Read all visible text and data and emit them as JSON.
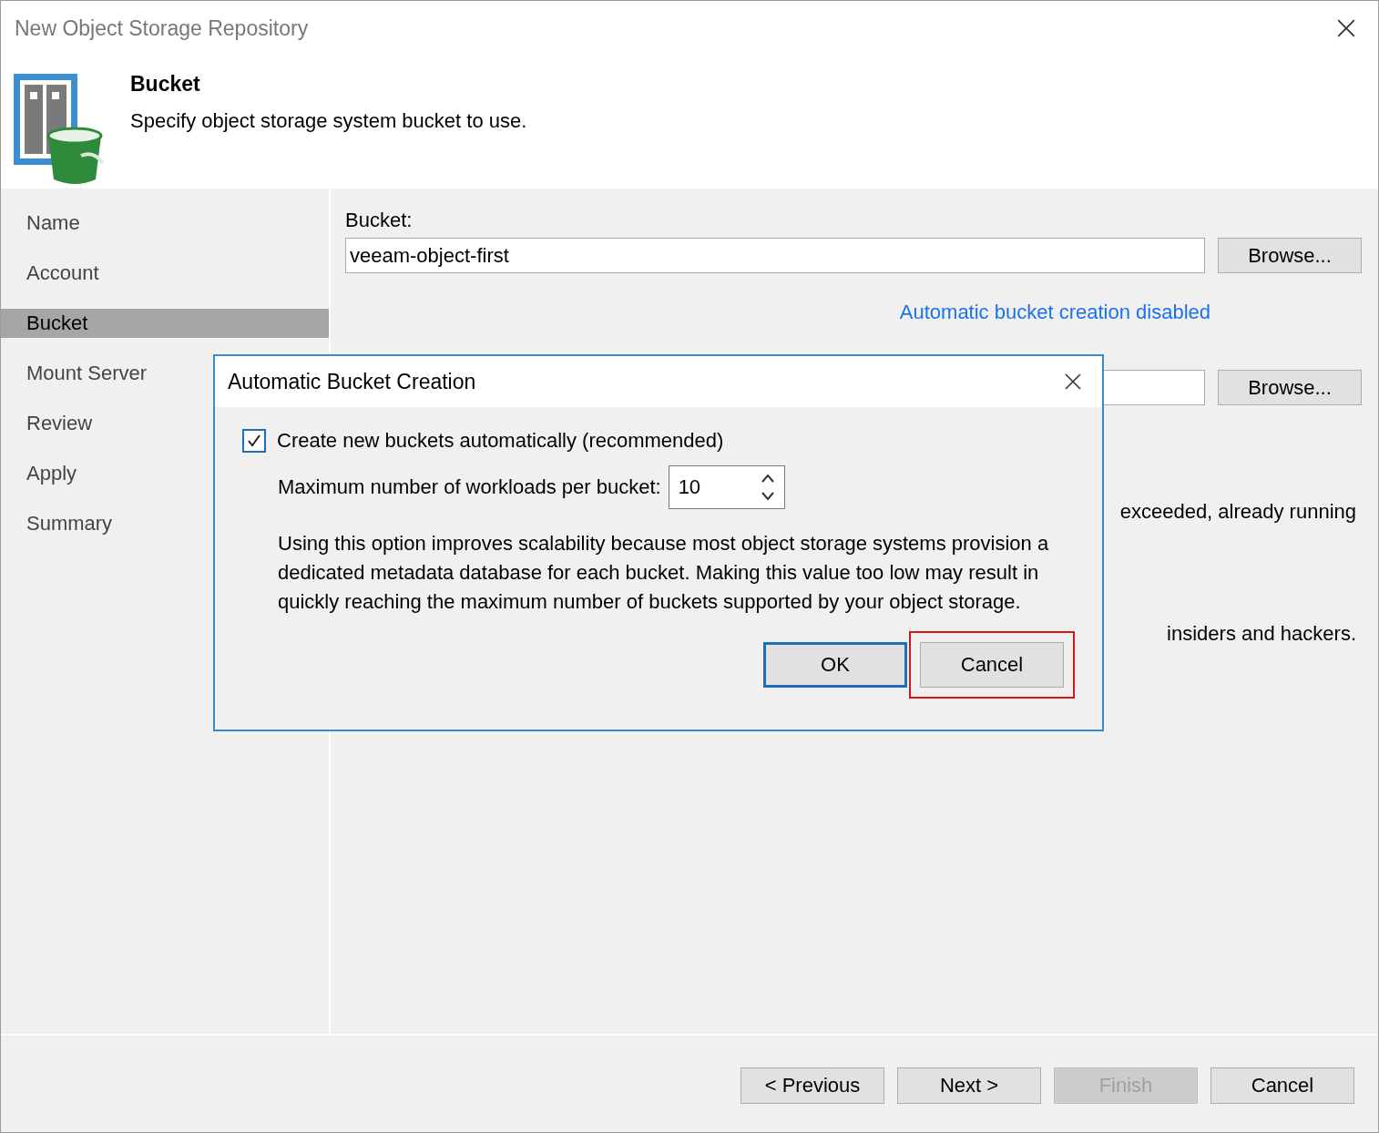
{
  "window": {
    "title": "New Object Storage Repository"
  },
  "header": {
    "title": "Bucket",
    "subtitle": "Specify object storage system bucket to use."
  },
  "sidebar": {
    "items": [
      {
        "label": "Name",
        "selected": false
      },
      {
        "label": "Account",
        "selected": false
      },
      {
        "label": "Bucket",
        "selected": true
      },
      {
        "label": "Mount Server",
        "selected": false
      },
      {
        "label": "Review",
        "selected": false
      },
      {
        "label": "Apply",
        "selected": false
      },
      {
        "label": "Summary",
        "selected": false
      }
    ]
  },
  "content": {
    "bucket_label": "Bucket:",
    "bucket_value": "veeam-object-first",
    "browse_buttons": [
      "Browse...",
      "Browse..."
    ],
    "auto_creation_link": "Automatic bucket creation disabled",
    "partial_texts": [
      "exceeded, already running",
      "insiders and hackers."
    ]
  },
  "dialog": {
    "title": "Automatic Bucket Creation",
    "checkbox": {
      "label": "Create new buckets automatically (recommended)",
      "checked": true
    },
    "max_label": "Maximum number of workloads per bucket:",
    "max_value": "10",
    "description": "Using this option improves scalability because most object storage systems provision a dedicated metadata database for each bucket. Making this value too low may result in quickly reaching the maximum number of buckets supported by your object storage.",
    "buttons": [
      {
        "label": "OK",
        "default": true,
        "highlighted": false
      },
      {
        "label": "Cancel",
        "default": false,
        "highlighted": true
      }
    ]
  },
  "footer": {
    "buttons": [
      {
        "label": "< Previous",
        "disabled": false
      },
      {
        "label": "Next >",
        "disabled": false
      },
      {
        "label": "Finish",
        "disabled": true
      },
      {
        "label": "Cancel",
        "disabled": false
      }
    ]
  }
}
